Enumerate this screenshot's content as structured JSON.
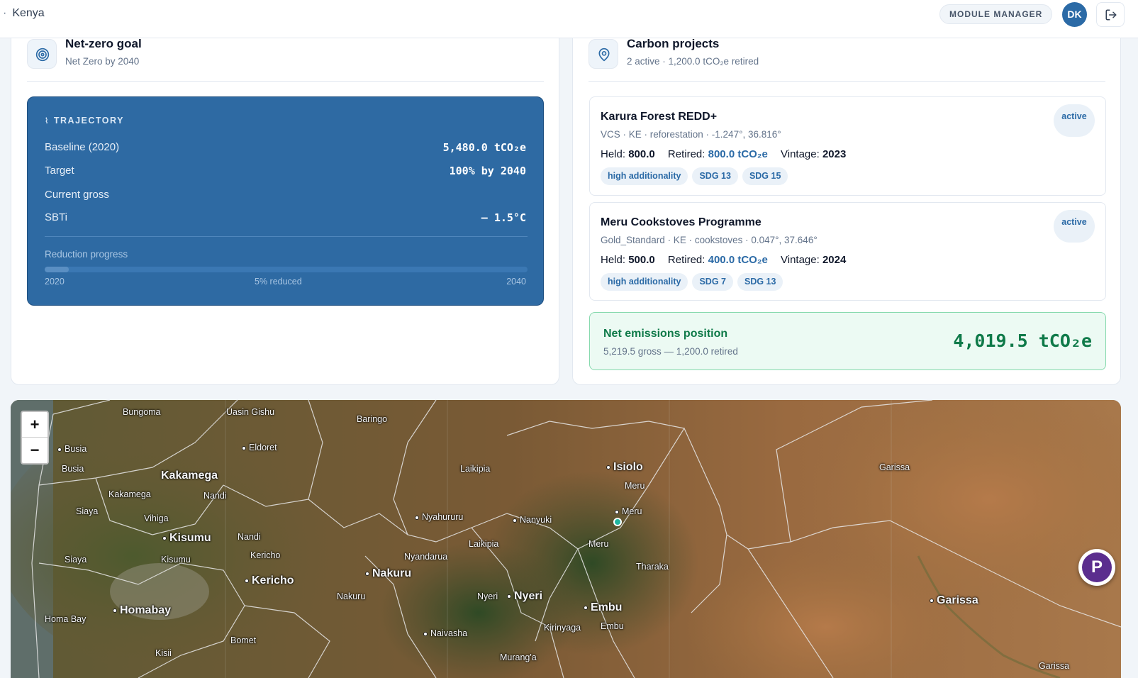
{
  "header": {
    "breadcrumb": "Kenya",
    "module_manager_label": "MODULE MANAGER",
    "avatar_initials": "DK"
  },
  "netzero": {
    "title": "Net-zero goal",
    "subtitle": "Net Zero by 2040",
    "trajectory": {
      "label": "TRAJECTORY",
      "rows": [
        {
          "label": "Baseline (2020)",
          "value": "5,480.0 tCO₂e"
        },
        {
          "label": "Target",
          "value": "100% by 2040"
        },
        {
          "label": "Current gross",
          "value": ""
        },
        {
          "label": "SBTi",
          "value": "— 1.5°C"
        }
      ],
      "progress_label": "Reduction progress",
      "progress_fraction": 0.05,
      "axis_start": "2020",
      "axis_middle": "5% reduced",
      "axis_end": "2040"
    }
  },
  "carbon": {
    "title": "Carbon projects",
    "subtitle": "2 active · 1,200.0 tCO₂e retired",
    "held_label": "Held:",
    "retired_label": "Retired:",
    "vintage_label": "Vintage:",
    "projects": [
      {
        "name": "Karura Forest REDD+",
        "meta": "VCS · KE · reforestation · -1.247°, 36.816°",
        "held": "800.0",
        "retired": "800.0 tCO₂e",
        "vintage": "2023",
        "status": "active",
        "tags": [
          "high additionality",
          "SDG 13",
          "SDG 15"
        ]
      },
      {
        "name": "Meru Cookstoves Programme",
        "meta": "Gold_Standard · KE · cookstoves · 0.047°, 37.646°",
        "held": "500.0",
        "retired": "400.0 tCO₂e",
        "vintage": "2024",
        "status": "active",
        "tags": [
          "high additionality",
          "SDG 7",
          "SDG 13"
        ]
      }
    ],
    "net": {
      "title": "Net emissions position",
      "subtitle": "5,219.5 gross — 1,200.0 retired",
      "value": "4,019.5 tCO₂e"
    }
  },
  "map": {
    "zoom_in": "+",
    "zoom_out": "−",
    "fab_label": "P",
    "towns": [
      "Bungoma",
      "Uasin Gishu",
      "Baringo",
      "Busia",
      "Busia",
      "Eldoret",
      "Kakamega",
      "Kakamega",
      "Nandi",
      "Siaya",
      "Vihiga",
      "Kisumu",
      "Nandi",
      "Siaya",
      "Kisumu",
      "Kericho",
      "Kericho",
      "Homabay",
      "Homa Bay",
      "Bomet",
      "Kisii",
      "Laikipia",
      "Isiolo",
      "Meru",
      "Meru",
      "Nyahururu",
      "Nanyuki",
      "Laikipia",
      "Meru",
      "Nyandarua",
      "Nakuru",
      "Nakuru",
      "Tharaka",
      "Nyeri",
      "Nyeri",
      "Embu",
      "Embu",
      "Kirinyaga",
      "Naivasha",
      "Murang'a",
      "Garissa",
      "Garissa",
      "Garissa"
    ]
  }
}
